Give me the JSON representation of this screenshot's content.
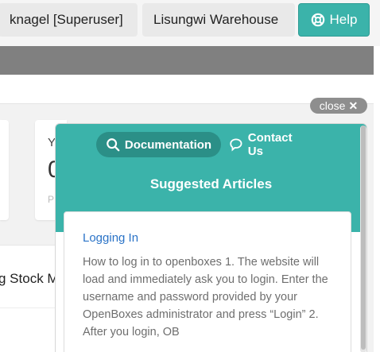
{
  "header": {
    "user_label": "knagel [Superuser]",
    "location_label": "Lisungwi Warehouse",
    "help_label": "Help",
    "help_icon": "lifebuoy-icon"
  },
  "background": {
    "card_partial_title": "Y",
    "card_partial_value": "0",
    "card_partial_sub": "P",
    "list_partial_text": "g Stock M"
  },
  "help_widget": {
    "close_label": "close",
    "close_icon": "x-icon",
    "tabs": [
      {
        "label": "Documentation",
        "icon": "search-icon",
        "active": true
      },
      {
        "label": "Contact Us",
        "icon": "chat-bubble-icon",
        "active": false
      }
    ],
    "section_title": "Suggested Articles",
    "articles": [
      {
        "title": "Logging In",
        "excerpt": "How to log in to openboxes 1. The website will load and immediately ask you to login. Enter the username and password provided by your OpenBoxes administrator and press “Login” 2. After you login, OB"
      }
    ]
  },
  "colors": {
    "accent": "#3bb3aa",
    "accent_dark": "#2b8f87",
    "link": "#2a73c7",
    "navbar": "#808080"
  }
}
